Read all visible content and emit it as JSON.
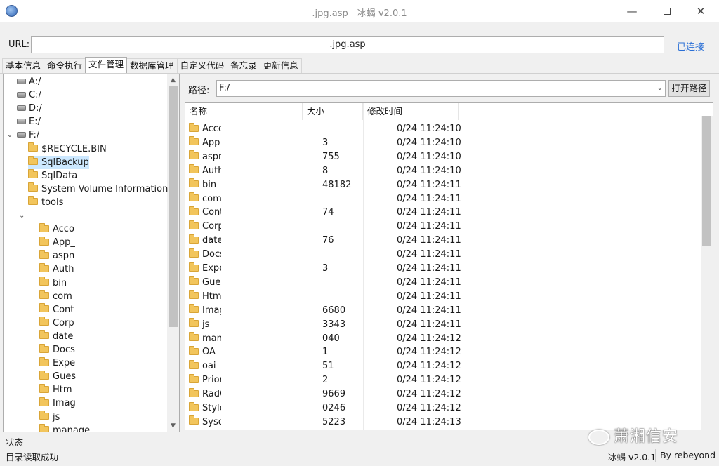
{
  "window": {
    "title": ".jpg.asp　冰蝎 v2.0.1",
    "minimize_icon": "minimize-icon",
    "maximize_icon": "maximize-icon",
    "close_icon": "close-icon"
  },
  "url_bar": {
    "label": "URL:",
    "value": ".jpg.asp",
    "status": "已连接"
  },
  "tabs": [
    "基本信息",
    "命令执行",
    "文件管理",
    "数据库管理",
    "自定义代码",
    "备忘录",
    "更新信息"
  ],
  "active_tab": "文件管理",
  "tree": {
    "drives": [
      "A:/",
      "C:/",
      "D:/",
      "E:/",
      "F:/"
    ],
    "f_children": [
      "$RECYCLE.BIN",
      "SqlBackup",
      "SqlData",
      "System Volume Information",
      "tools"
    ],
    "selected": "SqlBackup",
    "sub_children": [
      "Acco",
      "App_",
      "aspn",
      "Auth",
      "bin",
      "com",
      "Cont",
      "Corp",
      "date",
      "Docs",
      "Expe",
      "Gues",
      "Htm",
      "Imag",
      "js",
      "manage"
    ]
  },
  "path": {
    "label": "路径:",
    "value": "F:/",
    "open_button": "打开路径"
  },
  "file_list": {
    "headers": {
      "name": "名称",
      "size": "大小",
      "mtime": "修改时间"
    },
    "rows": [
      {
        "name": "Acco",
        "size": "",
        "mtime": "0/24 11:24:10"
      },
      {
        "name": "App_",
        "size": "3",
        "mtime": "0/24 11:24:10"
      },
      {
        "name": "aspn",
        "size": "755",
        "mtime": "0/24 11:24:10"
      },
      {
        "name": "Auth",
        "size": "8",
        "mtime": "0/24 11:24:10"
      },
      {
        "name": "bin",
        "size": "48182",
        "mtime": "0/24 11:24:11"
      },
      {
        "name": "comi",
        "size": "",
        "mtime": "0/24 11:24:11"
      },
      {
        "name": "Cont",
        "size": "74",
        "mtime": "0/24 11:24:11"
      },
      {
        "name": "Corp",
        "size": "",
        "mtime": "0/24 11:24:11"
      },
      {
        "name": "date",
        "size": "76",
        "mtime": "0/24 11:24:11"
      },
      {
        "name": "Docs",
        "size": "",
        "mtime": "0/24 11:24:11"
      },
      {
        "name": "Expe",
        "size": "3",
        "mtime": "0/24 11:24:11"
      },
      {
        "name": "Gues",
        "size": "",
        "mtime": "0/24 11:24:11"
      },
      {
        "name": "Html",
        "size": "",
        "mtime": "0/24 11:24:11"
      },
      {
        "name": "Imag",
        "size": "6680",
        "mtime": "0/24 11:24:11"
      },
      {
        "name": "js",
        "size": "3343",
        "mtime": "0/24 11:24:11"
      },
      {
        "name": "mana",
        "size": "040",
        "mtime": "0/24 11:24:12"
      },
      {
        "name": "OA",
        "size": "1",
        "mtime": "0/24 11:24:12"
      },
      {
        "name": "oai",
        "size": "51",
        "mtime": "0/24 11:24:12"
      },
      {
        "name": "Prior",
        "size": "2",
        "mtime": "0/24 11:24:12"
      },
      {
        "name": "RadC",
        "size": "9669",
        "mtime": "0/24 11:24:12"
      },
      {
        "name": "Style",
        "size": "0246",
        "mtime": "0/24 11:24:12"
      },
      {
        "name": "Syscs",
        "size": "5223",
        "mtime": "0/24 11:24:13"
      }
    ]
  },
  "status_bar": {
    "title": "状态",
    "message": "目录读取成功",
    "version": "冰蝎 v2.0.1",
    "author": "By rebeyond"
  },
  "watermark": "萧湘信安"
}
